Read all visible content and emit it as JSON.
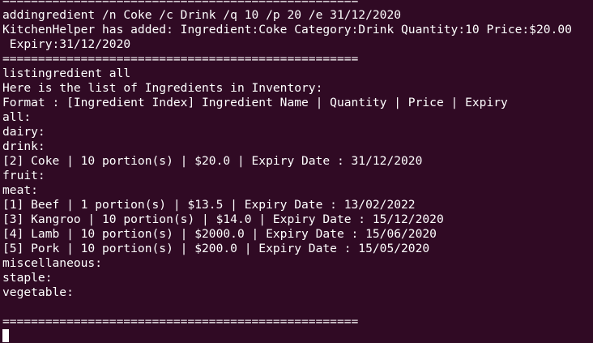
{
  "terminal": {
    "lines": [
      "==================================================",
      "addingredient /n Coke /c Drink /q 10 /p 20 /e 31/12/2020",
      "KitchenHelper has added: Ingredient:Coke Category:Drink Quantity:10 Price:$20.00",
      " Expiry:31/12/2020",
      "==================================================",
      "listingredient all",
      "Here is the list of Ingredients in Inventory:",
      "Format : [Ingredient Index] Ingredient Name | Quantity | Price | Expiry",
      "all:",
      "dairy:",
      "drink:",
      "[2] Coke | 10 portion(s) | $20.0 | Expiry Date : 31/12/2020",
      "fruit:",
      "meat:",
      "[1] Beef | 1 portion(s) | $13.5 | Expiry Date : 13/02/2022",
      "[3] Kangroo | 10 portion(s) | $14.0 | Expiry Date : 15/12/2020",
      "[4] Lamb | 10 portion(s) | $2000.0 | Expiry Date : 15/06/2020",
      "[5] Pork | 10 portion(s) | $200.0 | Expiry Date : 15/05/2020",
      "miscellaneous:",
      "staple:",
      "vegetable:",
      "",
      "=================================================="
    ]
  },
  "colors": {
    "background": "#300a24",
    "foreground": "#ffffff"
  }
}
